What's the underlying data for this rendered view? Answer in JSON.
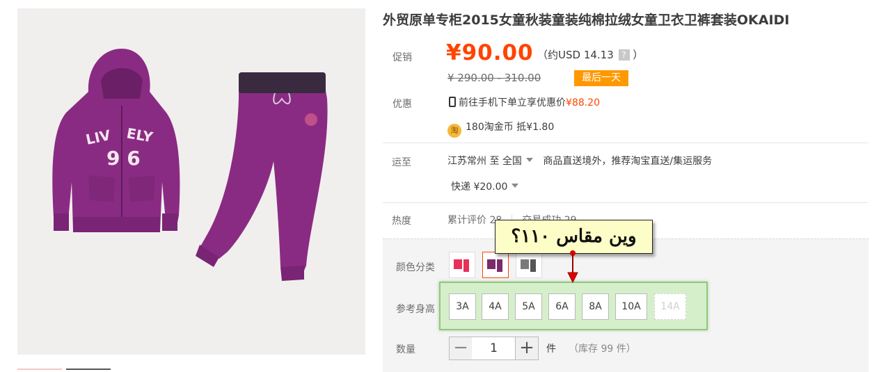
{
  "product": {
    "title": "外贸原单专柜2015女童秋装童装纯棉拉绒女童卫衣卫裤套装OKAIDI"
  },
  "price": {
    "promo_label": "促销",
    "current": "¥90.00",
    "approx_prefix": "（约USD 14.13",
    "approx_suffix": "）",
    "help_icon": "?",
    "original": "¥ 290.00 - 310.00",
    "last_day_badge": "最后一天"
  },
  "discount": {
    "label": "优惠",
    "phone_text": "前往手机下单立享优惠价",
    "phone_price": "¥88.20",
    "coin_icon": "淘",
    "coin_text": "180淘金币 抵¥1.80"
  },
  "shipping": {
    "label": "运至",
    "from": "江苏常州 至",
    "to": "全国",
    "note": "商品直送境外，推荐淘宝直送/集运服务",
    "express": "快递 ¥20.00"
  },
  "heat": {
    "label": "热度",
    "reviews": "累计评价 28",
    "deals": "交易成功 29"
  },
  "sku": {
    "color_label": "颜色分类",
    "colors": [
      {
        "name": "pink",
        "color": "#e8305a",
        "selected": false
      },
      {
        "name": "purple",
        "color": "#7a2a6a",
        "selected": true
      },
      {
        "name": "grey",
        "color": "#7a7a7a",
        "selected": false
      }
    ],
    "size_label": "参考身高",
    "sizes": [
      "3A",
      "4A",
      "5A",
      "6A",
      "8A",
      "10A",
      "14A"
    ],
    "size_disabled_index": 6,
    "quantity_label": "数量",
    "quantity": "1",
    "quantity_unit": "件",
    "stock": "（库存 99 件）"
  },
  "annotation": {
    "text": "وين مقاس ١١٠؟"
  },
  "colors": {
    "accent": "#ff4400",
    "badge": "#ff9900",
    "garment": "#8a2b83",
    "highlight": "#8fc97a"
  }
}
